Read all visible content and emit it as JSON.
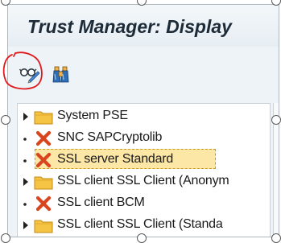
{
  "window": {
    "title": "Trust Manager: Display"
  },
  "toolbar": {
    "buttons": [
      {
        "icon": "glasses-pencil-icon",
        "tooltip": ""
      },
      {
        "icon": "binoculars-icon",
        "tooltip": ""
      }
    ],
    "highlight_color": "#e0191c"
  },
  "tree": {
    "items": [
      {
        "label": "System PSE",
        "icon": "folder-icon",
        "expander": "collapsed",
        "selected": false
      },
      {
        "label": "SNC SAPCryptolib",
        "icon": "error-x-icon",
        "expander": "leaf",
        "selected": false
      },
      {
        "label": "SSL server Standard",
        "icon": "error-x-icon",
        "expander": "leaf",
        "selected": true
      },
      {
        "label": "SSL client SSL Client (Anonym",
        "icon": "folder-icon",
        "expander": "collapsed",
        "selected": false
      },
      {
        "label": "SSL client BCM",
        "icon": "error-x-icon",
        "expander": "leaf",
        "selected": false
      },
      {
        "label": "SSL client SSL Client (Standa",
        "icon": "folder-icon",
        "expander": "collapsed",
        "selected": false
      }
    ]
  },
  "colors": {
    "folder": "#f6c445",
    "error": "#d9451e",
    "selection": "#fce7a6",
    "title_text": "#1d2b38"
  }
}
